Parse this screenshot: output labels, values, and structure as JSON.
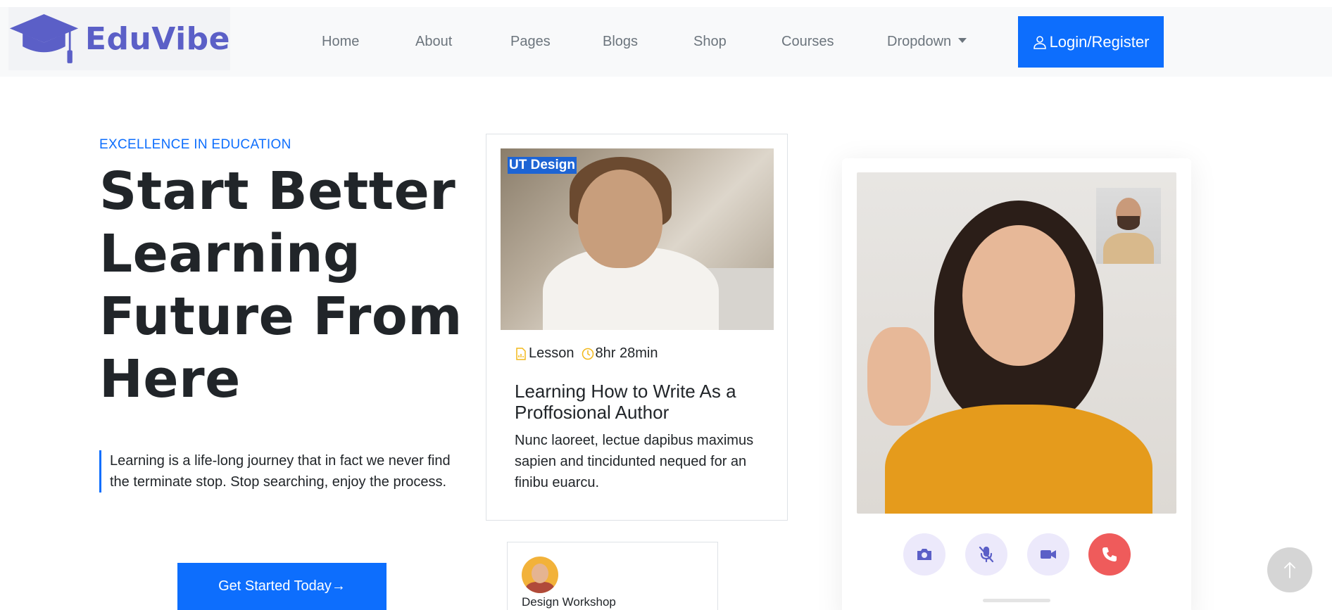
{
  "brand": {
    "name": "EduVibe",
    "logo_icon": "graduation-cap-icon",
    "color": "#5b5fc7"
  },
  "nav": {
    "items": [
      {
        "label": "Home"
      },
      {
        "label": "About"
      },
      {
        "label": "Pages"
      },
      {
        "label": "Blogs"
      },
      {
        "label": "Shop"
      },
      {
        "label": "Courses"
      },
      {
        "label": "Dropdown",
        "has_caret": true
      }
    ],
    "login_label": "Login/Register",
    "login_icon": "user-icon"
  },
  "hero": {
    "eyebrow": "EXCELLENCE IN EDUCATION",
    "title": "Start Better Learning Future From Here",
    "quote": "Learning is a life-long journey that in fact we never find the terminate stop. Stop searching, enjoy the process.",
    "cta_label": "Get Started Today→"
  },
  "course_card": {
    "badge": "UT Design",
    "lesson_label": "Lesson",
    "lesson_icon": "file-chart-icon",
    "duration": "8hr 28min",
    "duration_icon": "clock-icon",
    "title": "Learning How to Write As a Proffosional Author",
    "description": "Nunc laoreet, lectue dapibus maximus sapien and tincidunted nequed for an finibu euarcu."
  },
  "workshop_card": {
    "label": "Design Workshop",
    "avatar": "avatar",
    "status_color": "#20c05c"
  },
  "video_call": {
    "controls": [
      {
        "name": "camera-button",
        "icon": "camera-icon"
      },
      {
        "name": "mute-button",
        "icon": "mic-off-icon"
      },
      {
        "name": "video-button",
        "icon": "video-icon"
      },
      {
        "name": "end-call-button",
        "icon": "phone-icon"
      }
    ]
  },
  "colors": {
    "primary": "#0d6efd",
    "accent": "#5b5fc7",
    "end_call": "#ef5b5b",
    "meta_icon": "#f2b81a"
  },
  "scroll_top_icon": "arrow-up-icon"
}
